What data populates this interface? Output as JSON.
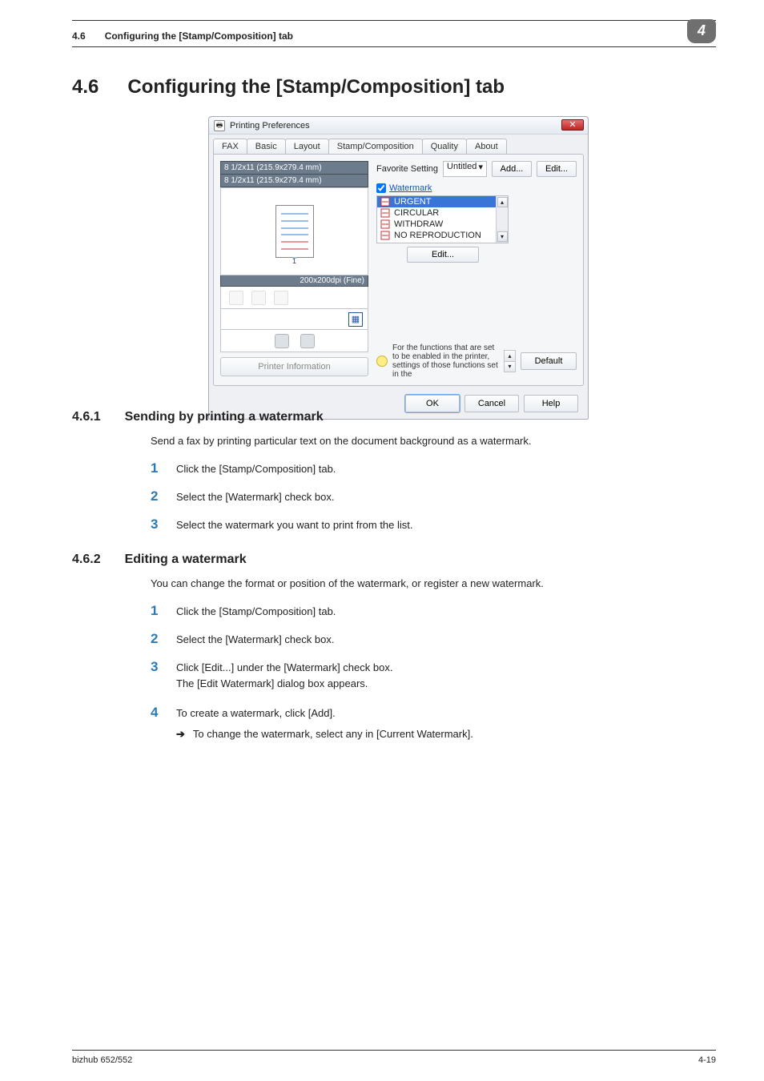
{
  "header": {
    "section_num": "4.6",
    "section_title": "Configuring the [Stamp/Composition] tab",
    "chapter_badge": "4"
  },
  "h1": {
    "num": "4.6",
    "title": "Configuring the [Stamp/Composition] tab"
  },
  "dialog": {
    "window_title": "Printing Preferences",
    "close_x": "✕",
    "tabs": {
      "fax": "FAX",
      "basic": "Basic",
      "layout": "Layout",
      "stamp": "Stamp/Composition",
      "quality": "Quality",
      "about": "About"
    },
    "left": {
      "paper1": "8 1/2x11 (215.9x279.4 mm)",
      "paper2": "8 1/2x11 (215.9x279.4 mm)",
      "page_number": "1",
      "dpi": "200x200dpi (Fine)",
      "printer_info": "Printer Information"
    },
    "right": {
      "favorite_label": "Favorite Setting",
      "favorite_value": "Untitled",
      "add_btn": "Add...",
      "edit_btn": "Edit...",
      "watermark_label": "Watermark",
      "items": [
        "URGENT",
        "CIRCULAR",
        "WITHDRAW",
        "NO REPRODUCTION"
      ],
      "list_edit_btn": "Edit...",
      "status_text": "For the functions that are set to be enabled in the printer, settings of those functions set in the",
      "default_btn": "Default"
    },
    "bottom": {
      "ok": "OK",
      "cancel": "Cancel",
      "help": "Help"
    }
  },
  "sec461": {
    "num": "4.6.1",
    "title": "Sending by printing a watermark",
    "para": "Send a fax by printing particular text on the document background as a watermark.",
    "steps": {
      "s1": "Click the [Stamp/Composition] tab.",
      "s2": "Select the [Watermark] check box.",
      "s3": "Select the watermark you want to print from the list."
    }
  },
  "sec462": {
    "num": "4.6.2",
    "title": "Editing a watermark",
    "para": "You can change the format or position of the watermark, or register a new watermark.",
    "steps": {
      "s1": "Click the [Stamp/Composition] tab.",
      "s2": "Select the [Watermark] check box.",
      "s3a": "Click [Edit...] under the [Watermark] check box.",
      "s3b": "The [Edit Watermark] dialog box appears.",
      "s4": "To create a watermark, click [Add].",
      "s4sub": "To change the watermark, select any in [Current Watermark]."
    }
  },
  "nums": {
    "n1": "1",
    "n2": "2",
    "n3": "3",
    "n4": "4"
  },
  "arrow": "➔",
  "footer": {
    "left": "bizhub 652/552",
    "right": "4-19"
  }
}
